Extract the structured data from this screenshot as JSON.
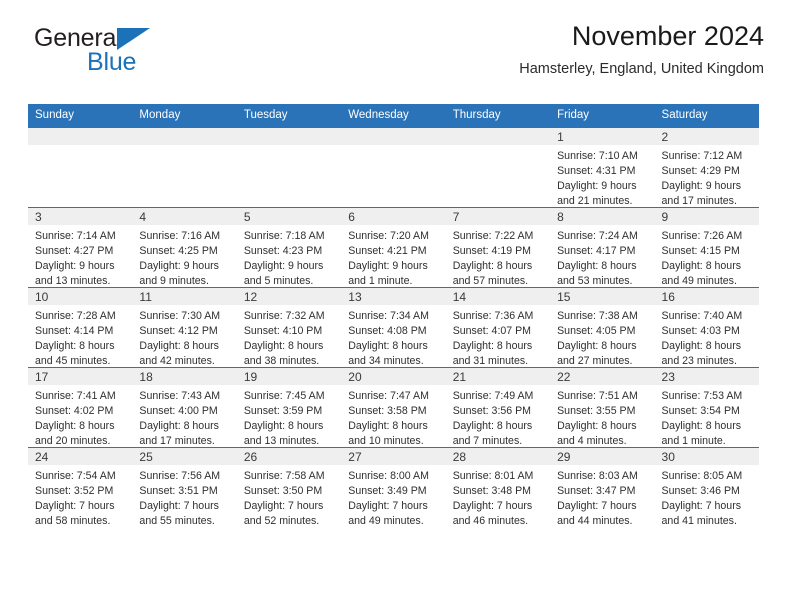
{
  "brand": {
    "name_part1": "General",
    "name_part2": "Blue",
    "triangle_color": "#1b72b8"
  },
  "header": {
    "title": "November 2024",
    "subtitle": "Hamsterley, England, United Kingdom",
    "header_bg": "#2a73b8",
    "daynum_bg": "#efefef"
  },
  "weekday_headers": [
    "Sunday",
    "Monday",
    "Tuesday",
    "Wednesday",
    "Thursday",
    "Friday",
    "Saturday"
  ],
  "weeks": [
    [
      {
        "day": "",
        "sunrise": "",
        "sunset": "",
        "daylight_line1": "",
        "daylight_line2": ""
      },
      {
        "day": "",
        "sunrise": "",
        "sunset": "",
        "daylight_line1": "",
        "daylight_line2": ""
      },
      {
        "day": "",
        "sunrise": "",
        "sunset": "",
        "daylight_line1": "",
        "daylight_line2": ""
      },
      {
        "day": "",
        "sunrise": "",
        "sunset": "",
        "daylight_line1": "",
        "daylight_line2": ""
      },
      {
        "day": "",
        "sunrise": "",
        "sunset": "",
        "daylight_line1": "",
        "daylight_line2": ""
      },
      {
        "day": "1",
        "sunrise": "Sunrise: 7:10 AM",
        "sunset": "Sunset: 4:31 PM",
        "daylight_line1": "Daylight: 9 hours",
        "daylight_line2": "and 21 minutes."
      },
      {
        "day": "2",
        "sunrise": "Sunrise: 7:12 AM",
        "sunset": "Sunset: 4:29 PM",
        "daylight_line1": "Daylight: 9 hours",
        "daylight_line2": "and 17 minutes."
      }
    ],
    [
      {
        "day": "3",
        "sunrise": "Sunrise: 7:14 AM",
        "sunset": "Sunset: 4:27 PM",
        "daylight_line1": "Daylight: 9 hours",
        "daylight_line2": "and 13 minutes."
      },
      {
        "day": "4",
        "sunrise": "Sunrise: 7:16 AM",
        "sunset": "Sunset: 4:25 PM",
        "daylight_line1": "Daylight: 9 hours",
        "daylight_line2": "and 9 minutes."
      },
      {
        "day": "5",
        "sunrise": "Sunrise: 7:18 AM",
        "sunset": "Sunset: 4:23 PM",
        "daylight_line1": "Daylight: 9 hours",
        "daylight_line2": "and 5 minutes."
      },
      {
        "day": "6",
        "sunrise": "Sunrise: 7:20 AM",
        "sunset": "Sunset: 4:21 PM",
        "daylight_line1": "Daylight: 9 hours",
        "daylight_line2": "and 1 minute."
      },
      {
        "day": "7",
        "sunrise": "Sunrise: 7:22 AM",
        "sunset": "Sunset: 4:19 PM",
        "daylight_line1": "Daylight: 8 hours",
        "daylight_line2": "and 57 minutes."
      },
      {
        "day": "8",
        "sunrise": "Sunrise: 7:24 AM",
        "sunset": "Sunset: 4:17 PM",
        "daylight_line1": "Daylight: 8 hours",
        "daylight_line2": "and 53 minutes."
      },
      {
        "day": "9",
        "sunrise": "Sunrise: 7:26 AM",
        "sunset": "Sunset: 4:15 PM",
        "daylight_line1": "Daylight: 8 hours",
        "daylight_line2": "and 49 minutes."
      }
    ],
    [
      {
        "day": "10",
        "sunrise": "Sunrise: 7:28 AM",
        "sunset": "Sunset: 4:14 PM",
        "daylight_line1": "Daylight: 8 hours",
        "daylight_line2": "and 45 minutes."
      },
      {
        "day": "11",
        "sunrise": "Sunrise: 7:30 AM",
        "sunset": "Sunset: 4:12 PM",
        "daylight_line1": "Daylight: 8 hours",
        "daylight_line2": "and 42 minutes."
      },
      {
        "day": "12",
        "sunrise": "Sunrise: 7:32 AM",
        "sunset": "Sunset: 4:10 PM",
        "daylight_line1": "Daylight: 8 hours",
        "daylight_line2": "and 38 minutes."
      },
      {
        "day": "13",
        "sunrise": "Sunrise: 7:34 AM",
        "sunset": "Sunset: 4:08 PM",
        "daylight_line1": "Daylight: 8 hours",
        "daylight_line2": "and 34 minutes."
      },
      {
        "day": "14",
        "sunrise": "Sunrise: 7:36 AM",
        "sunset": "Sunset: 4:07 PM",
        "daylight_line1": "Daylight: 8 hours",
        "daylight_line2": "and 31 minutes."
      },
      {
        "day": "15",
        "sunrise": "Sunrise: 7:38 AM",
        "sunset": "Sunset: 4:05 PM",
        "daylight_line1": "Daylight: 8 hours",
        "daylight_line2": "and 27 minutes."
      },
      {
        "day": "16",
        "sunrise": "Sunrise: 7:40 AM",
        "sunset": "Sunset: 4:03 PM",
        "daylight_line1": "Daylight: 8 hours",
        "daylight_line2": "and 23 minutes."
      }
    ],
    [
      {
        "day": "17",
        "sunrise": "Sunrise: 7:41 AM",
        "sunset": "Sunset: 4:02 PM",
        "daylight_line1": "Daylight: 8 hours",
        "daylight_line2": "and 20 minutes."
      },
      {
        "day": "18",
        "sunrise": "Sunrise: 7:43 AM",
        "sunset": "Sunset: 4:00 PM",
        "daylight_line1": "Daylight: 8 hours",
        "daylight_line2": "and 17 minutes."
      },
      {
        "day": "19",
        "sunrise": "Sunrise: 7:45 AM",
        "sunset": "Sunset: 3:59 PM",
        "daylight_line1": "Daylight: 8 hours",
        "daylight_line2": "and 13 minutes."
      },
      {
        "day": "20",
        "sunrise": "Sunrise: 7:47 AM",
        "sunset": "Sunset: 3:58 PM",
        "daylight_line1": "Daylight: 8 hours",
        "daylight_line2": "and 10 minutes."
      },
      {
        "day": "21",
        "sunrise": "Sunrise: 7:49 AM",
        "sunset": "Sunset: 3:56 PM",
        "daylight_line1": "Daylight: 8 hours",
        "daylight_line2": "and 7 minutes."
      },
      {
        "day": "22",
        "sunrise": "Sunrise: 7:51 AM",
        "sunset": "Sunset: 3:55 PM",
        "daylight_line1": "Daylight: 8 hours",
        "daylight_line2": "and 4 minutes."
      },
      {
        "day": "23",
        "sunrise": "Sunrise: 7:53 AM",
        "sunset": "Sunset: 3:54 PM",
        "daylight_line1": "Daylight: 8 hours",
        "daylight_line2": "and 1 minute."
      }
    ],
    [
      {
        "day": "24",
        "sunrise": "Sunrise: 7:54 AM",
        "sunset": "Sunset: 3:52 PM",
        "daylight_line1": "Daylight: 7 hours",
        "daylight_line2": "and 58 minutes."
      },
      {
        "day": "25",
        "sunrise": "Sunrise: 7:56 AM",
        "sunset": "Sunset: 3:51 PM",
        "daylight_line1": "Daylight: 7 hours",
        "daylight_line2": "and 55 minutes."
      },
      {
        "day": "26",
        "sunrise": "Sunrise: 7:58 AM",
        "sunset": "Sunset: 3:50 PM",
        "daylight_line1": "Daylight: 7 hours",
        "daylight_line2": "and 52 minutes."
      },
      {
        "day": "27",
        "sunrise": "Sunrise: 8:00 AM",
        "sunset": "Sunset: 3:49 PM",
        "daylight_line1": "Daylight: 7 hours",
        "daylight_line2": "and 49 minutes."
      },
      {
        "day": "28",
        "sunrise": "Sunrise: 8:01 AM",
        "sunset": "Sunset: 3:48 PM",
        "daylight_line1": "Daylight: 7 hours",
        "daylight_line2": "and 46 minutes."
      },
      {
        "day": "29",
        "sunrise": "Sunrise: 8:03 AM",
        "sunset": "Sunset: 3:47 PM",
        "daylight_line1": "Daylight: 7 hours",
        "daylight_line2": "and 44 minutes."
      },
      {
        "day": "30",
        "sunrise": "Sunrise: 8:05 AM",
        "sunset": "Sunset: 3:46 PM",
        "daylight_line1": "Daylight: 7 hours",
        "daylight_line2": "and 41 minutes."
      }
    ]
  ]
}
